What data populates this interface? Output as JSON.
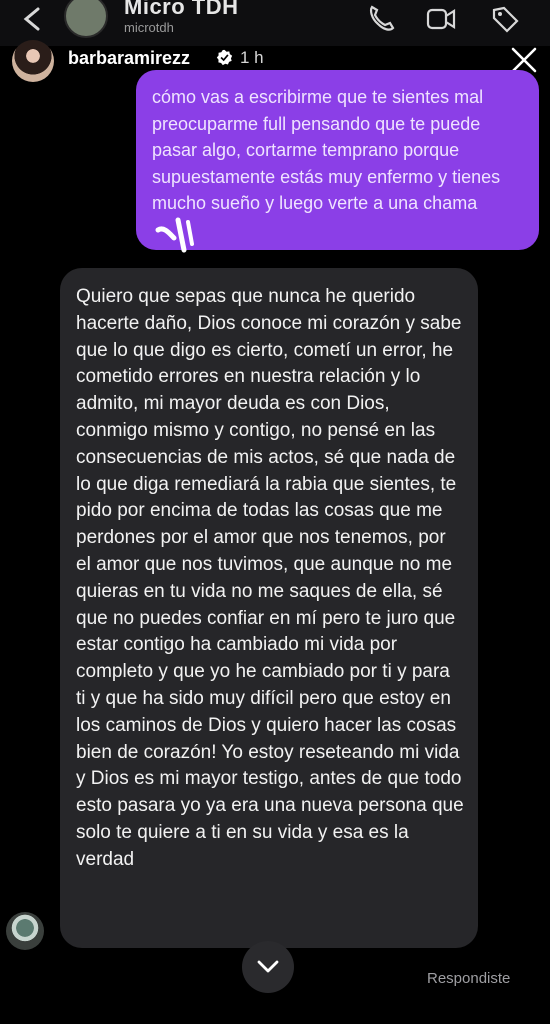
{
  "background_chat": {
    "title": "Micro TDH",
    "subtitle": "microtdh",
    "icons": [
      "back-arrow-icon",
      "phone-icon",
      "video-icon",
      "tag-icon"
    ]
  },
  "story": {
    "username": "barbaramirezz",
    "time": "1 h",
    "verified": true
  },
  "messages": [
    {
      "side": "right",
      "color": "#8b3fe7",
      "text": "cómo vas a escribirme que te sientes mal preocuparme full pensando que te puede pasar algo, cortarme temprano porque supuestamente estás muy enfermo y tienes mucho sueño y luego verte a una chama"
    },
    {
      "side": "left",
      "color": "#262629",
      "text": "Quiero que sepas que nunca he querido hacerte daño, Dios conoce mi corazón y sabe que lo que digo es cierto, cometí un error, he cometido errores en nuestra relación y lo admito, mi mayor deuda es con Dios, conmigo mismo y contigo, no pensé en las consecuencias de mis actos, sé que nada de lo que diga remediará la rabia que sientes, te pido por encima de todas las cosas que me perdones por el amor que nos tenemos, por el amor que nos tuvimos, que aunque no me quieras en tu vida no me saques de ella, sé que no puedes confiar en mí pero te juro que estar contigo ha cambiado mi vida por completo y que yo he cambiado por ti y para ti y que ha sido muy difícil pero que estoy en los caminos de Dios y quiero hacer las cosas bien de corazón! Yo estoy reseteando mi vida y Dios es mi mayor testigo, antes de que todo esto pasara yo ya era una nueva persona que solo te quiere a ti en su vida y esa es la verdad"
    }
  ],
  "footer": {
    "status": "Respondiste",
    "scroll_icon": "chevron-down-icon"
  }
}
